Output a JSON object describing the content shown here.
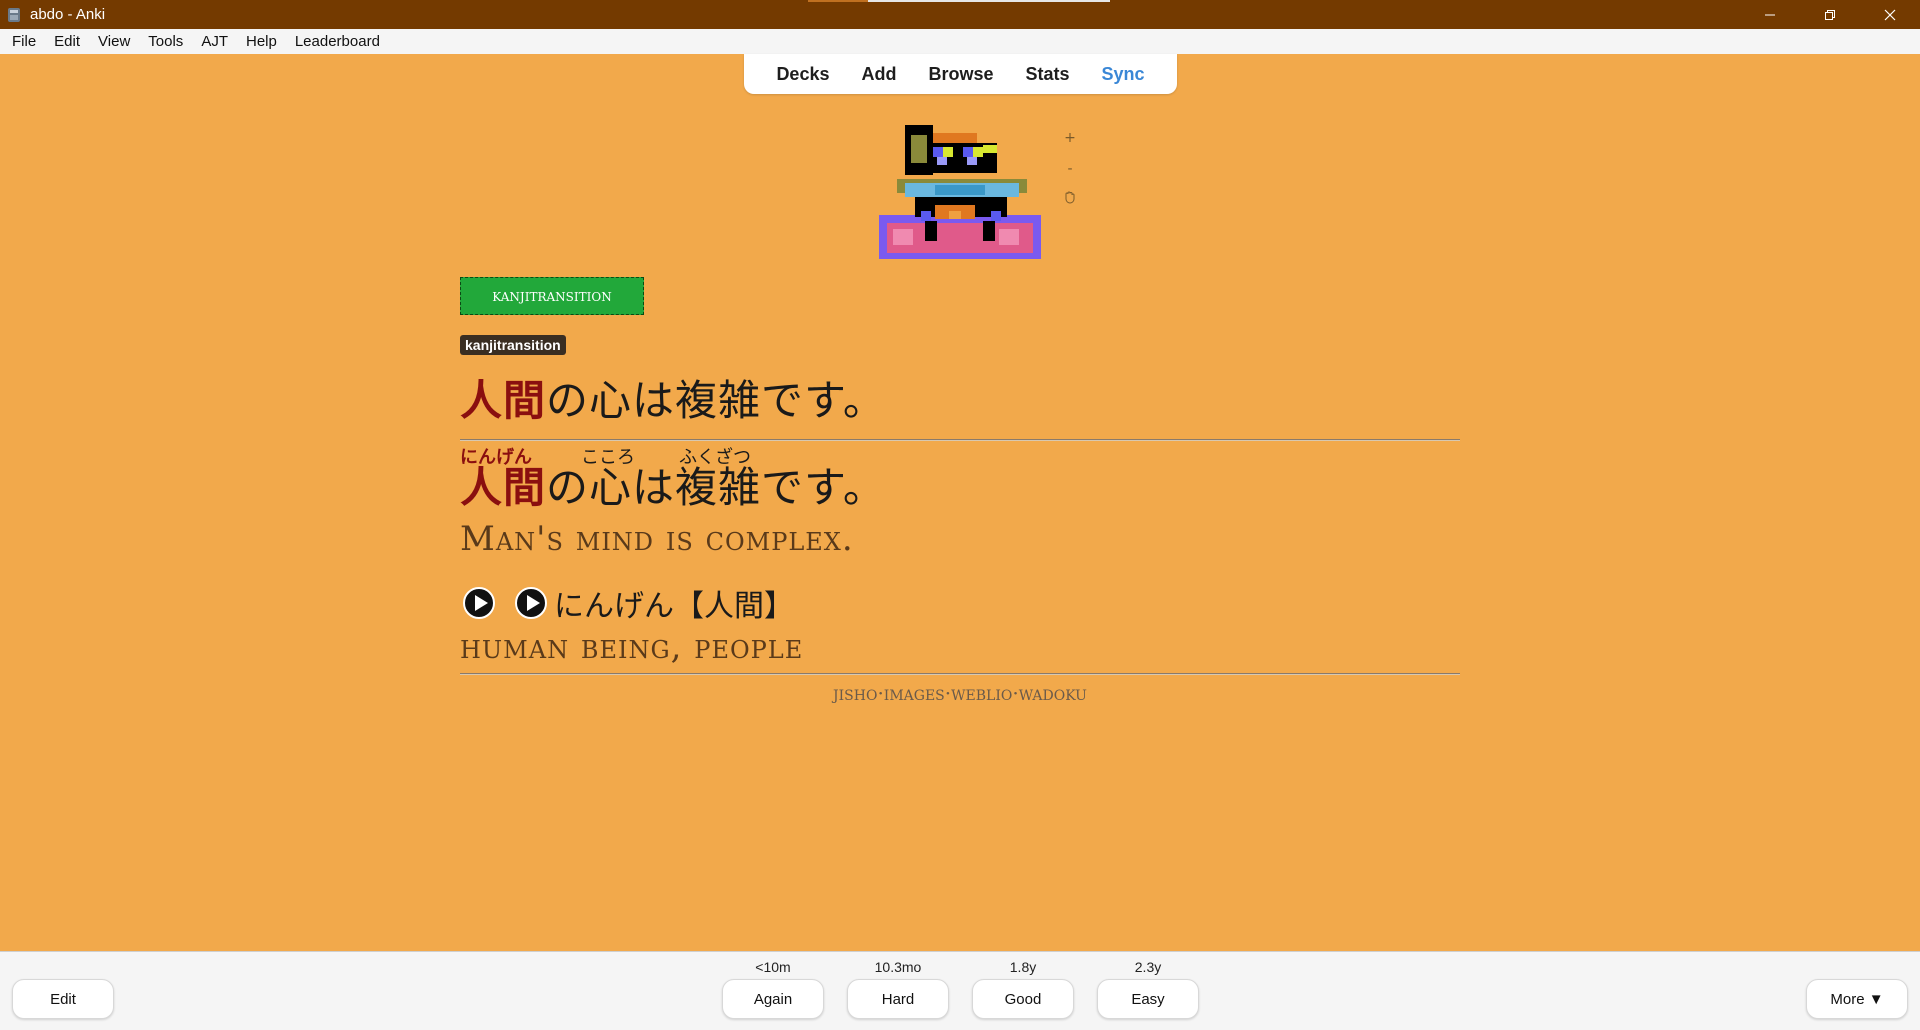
{
  "window": {
    "title": "abdo - Anki"
  },
  "menu": [
    "File",
    "Edit",
    "View",
    "Tools",
    "AJT",
    "Help",
    "Leaderboard"
  ],
  "toolbar": {
    "decks": "Decks",
    "add": "Add",
    "browse": "Browse",
    "stats": "Stats",
    "sync": "Sync"
  },
  "pet_controls": {
    "plus": "+",
    "minus": "-"
  },
  "card": {
    "deck_badge": "kanjitransition",
    "tag": "kanjitransition",
    "sentence_highlight": "人間",
    "sentence_rest": "の心は複雑です。",
    "furigana": [
      "にんげん",
      "こころ",
      "ふくざつ"
    ],
    "translation": "Man's mind is complex.",
    "vocab": "にんげん【人間】",
    "vocab_meaning": "human being, people",
    "links": [
      "jisho",
      "images",
      "weblio",
      "wadoku"
    ],
    "separator": "·"
  },
  "bottom": {
    "edit": "Edit",
    "more": "More ▼",
    "answers": [
      {
        "label": "Again",
        "interval": "<10m"
      },
      {
        "label": "Hard",
        "interval": "10.3mo"
      },
      {
        "label": "Good",
        "interval": "1.8y"
      },
      {
        "label": "Easy",
        "interval": "2.3y"
      }
    ]
  },
  "colors": {
    "background": "#f2a94b",
    "titlebar": "#743a00",
    "highlight": "#8a0f0f",
    "badge": "#22a83a",
    "sync": "#3a87d6"
  }
}
